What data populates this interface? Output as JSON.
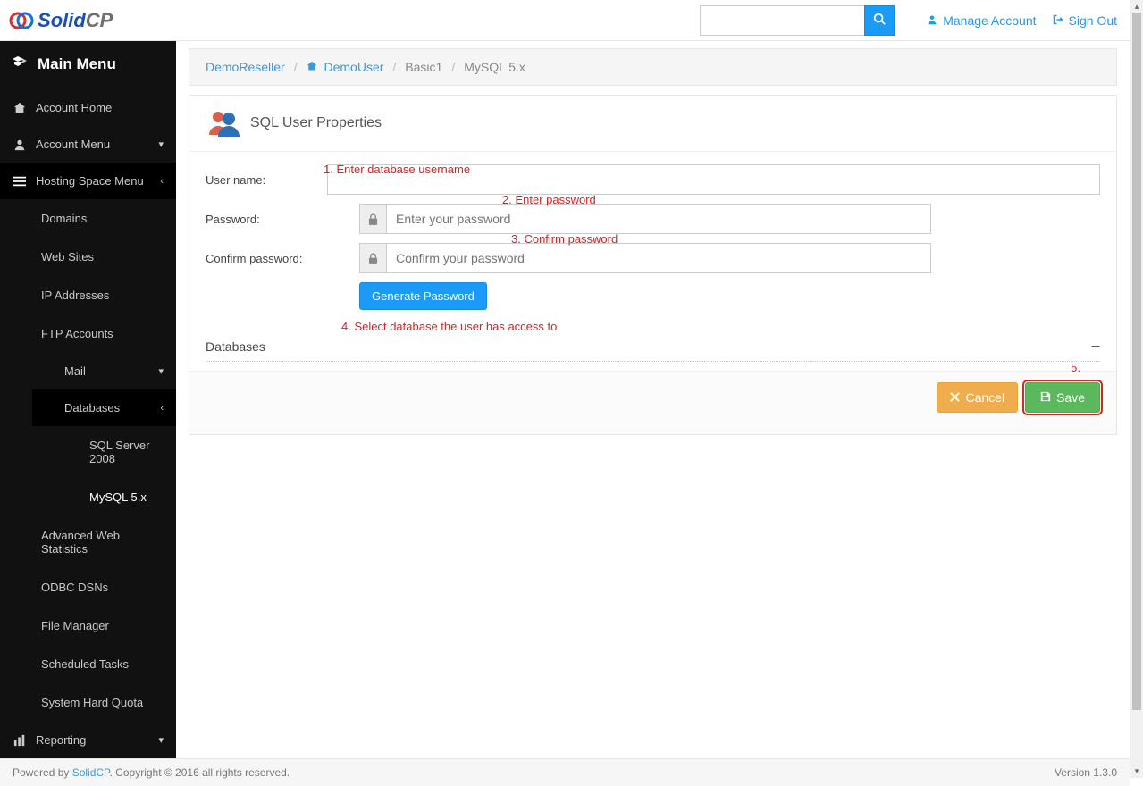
{
  "brand": {
    "part1": "S",
    "part2": "olid",
    "part3": "CP"
  },
  "header": {
    "search_placeholder": "",
    "manage_account": "Manage Account",
    "sign_out": "Sign Out"
  },
  "sidebar": {
    "main_menu": "Main Menu",
    "account_home": "Account Home",
    "account_menu": "Account Menu",
    "hosting_space_menu": "Hosting Space Menu",
    "items": {
      "domains": "Domains",
      "web_sites": "Web Sites",
      "ip_addresses": "IP Addresses",
      "ftp_accounts": "FTP Accounts",
      "mail": "Mail",
      "databases": "Databases",
      "db_children": {
        "sql2008": "SQL Server 2008",
        "mysql5x": "MySQL 5.x"
      },
      "adv_web_stats": "Advanced Web Statistics",
      "odbc_dsns": "ODBC DSNs",
      "file_manager": "File Manager",
      "scheduled_tasks": "Scheduled Tasks",
      "system_hard_quota": "System Hard Quota"
    },
    "reporting": "Reporting"
  },
  "breadcrumb": {
    "reseller": "DemoReseller",
    "user": "DemoUser",
    "plan": "Basic1",
    "db": "MySQL 5.x"
  },
  "panel": {
    "title": "SQL User Properties",
    "username_label": "User name:",
    "password_label": "Password:",
    "confirm_label": "Confirm password:",
    "password_placeholder": "Enter your password",
    "confirm_placeholder": "Confirm your password",
    "generate_button": "Generate Password",
    "databases_label": "Databases",
    "collapse": "–"
  },
  "annotations": {
    "a1": "1. Enter database username",
    "a2": "2. Enter password",
    "a3": "3. Confirm password",
    "a4": "4. Select database the user has access to",
    "a5": "5."
  },
  "buttons": {
    "cancel": "Cancel",
    "save": "Save"
  },
  "footer": {
    "prefix": "Powered by ",
    "link": "SolidCP",
    "suffix": ". Copyright © 2016 all rights reserved.",
    "version": "Version 1.3.0"
  }
}
